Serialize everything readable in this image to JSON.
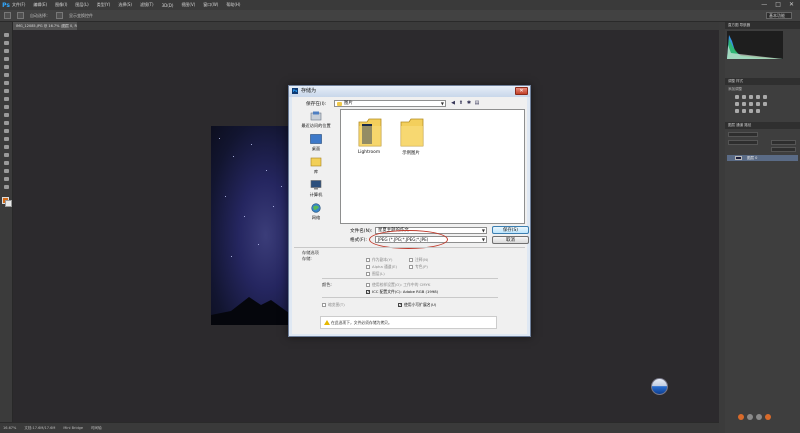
{
  "app": {
    "logo": "Ps",
    "menus": [
      "文件(F)",
      "编辑(E)",
      "图像(I)",
      "图层(L)",
      "类型(Y)",
      "选择(S)",
      "滤镜(T)",
      "3D(D)",
      "视图(V)",
      "窗口(W)",
      "帮助(H)"
    ],
    "window_controls": [
      "—",
      "□",
      "✕"
    ]
  },
  "options_bar": {
    "items": [
      "自动选择：",
      "显示变换控件"
    ],
    "workspace": "基本功能"
  },
  "document": {
    "tab_title": "IMG_12085.JPG @ 16.7% (图层 0, RGB/8)"
  },
  "statusbar": {
    "zoom": "16.67%",
    "doc_size": "文档:17.6M/17.6M",
    "mini_bridge": "Mini Bridge",
    "timeline": "时间轴"
  },
  "panels": {
    "histogram_tab": "直方图  导航器",
    "adjustments_tab": "调整  样式",
    "adjustments_hint": "添加调整",
    "layers_tab": "图层  通道  路径",
    "layer_name": "图层 0"
  },
  "dialog": {
    "title": "存储为",
    "close": "✕",
    "save_in_label": "保存在(I):",
    "save_in_value": "图片",
    "nav_icons": [
      "◀",
      "⬆",
      "✱",
      "▤"
    ],
    "places": [
      {
        "label": "最近访问的位置",
        "icon": "recent-places-icon"
      },
      {
        "label": "桌面",
        "icon": "desktop-icon"
      },
      {
        "label": "库",
        "icon": "library-icon"
      },
      {
        "label": "计算机",
        "icon": "computer-icon"
      },
      {
        "label": "网络",
        "icon": "network-icon"
      }
    ],
    "files": [
      {
        "name": "Lightroom"
      },
      {
        "name": "示例图片"
      }
    ],
    "filename_label": "文件名(N):",
    "filename_value": "星夏主题的作文",
    "format_label": "格式(F):",
    "format_value": "JPEG (*.JPG;*.JPEG;*.JPE)",
    "save_button": "保存(S)",
    "cancel_button": "取消",
    "options": {
      "storage_header": "存储选项",
      "storage_label": "存储:",
      "as_copy": "作为副本(Y)",
      "notes": "注释(N)",
      "alpha": "Alpha 通道(E)",
      "spot": "专色(P)",
      "layers": "图层(L)",
      "color_label": "颜色:",
      "use_proof": "使用校样设置(O): 工作中的 CMYK",
      "icc_profile": "ICC 配置文件(C): Adobe RGB (1998)",
      "icc_checked": "✓",
      "thumbnail": "缩览图(T)",
      "lowercase_ext": "使用小写扩展名(U)",
      "lowercase_checked": "✓",
      "warning": "在此选项下，文件必须存储为拷贝。"
    }
  }
}
